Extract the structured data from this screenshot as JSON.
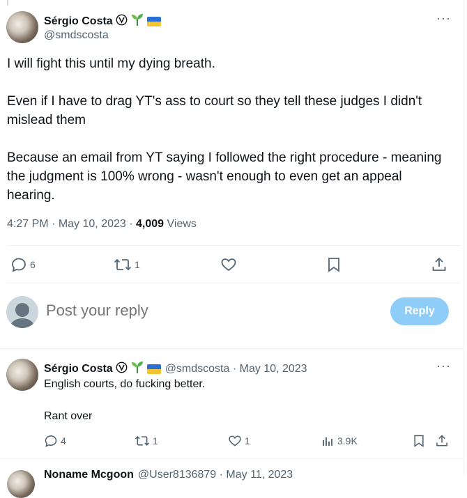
{
  "main_tweet": {
    "author_name": "Sérgio Costa",
    "handle": "@smdscosta",
    "more_label": "···",
    "paragraphs": [
      "I will fight this until my dying breath.",
      "Even if I have to drag YT's ass to court so they tell these judges I didn't mislead them",
      "Because an email from YT saying I followed the right procedure - meaning the judgment is 100% wrong -  wasn't enough to even get an appeal hearing."
    ],
    "time": "4:27 PM",
    "date": "May 10, 2023",
    "views_count": "4,009",
    "views_label": "Views",
    "replies": "6",
    "reposts": "1"
  },
  "reply_box": {
    "placeholder": "Post your reply",
    "button_label": "Reply"
  },
  "reply_tweet": {
    "author_name": "Sérgio Costa",
    "handle": "@smdscosta",
    "date": "May 10, 2023",
    "more_label": "···",
    "line1": "English courts, do fucking better.",
    "line2": "Rant over",
    "replies": "4",
    "reposts": "1",
    "likes": "1",
    "views": "3.9K"
  },
  "next_tweet": {
    "author_name": "Noname Mcgoon",
    "handle": "@User8136879",
    "date": "May 11, 2023"
  },
  "colors": {
    "text": "#0f1419",
    "muted": "#536471",
    "reply_button": "#8ecdf8",
    "flag_blue": "#2a6fd6",
    "flag_yellow": "#f4c430",
    "sprout": "#4caf50"
  }
}
